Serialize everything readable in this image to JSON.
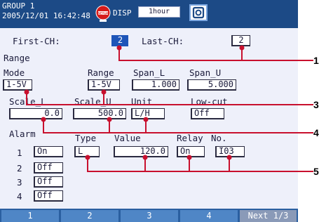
{
  "header": {
    "group": "GROUP 1",
    "datetime": "2005/12/01 16:42:48",
    "setup_badge": "SETUP",
    "disp_label": "DISP",
    "time_span": "1hour"
  },
  "channels": {
    "first_label": "First-CH:",
    "first_value": "2",
    "last_label": "Last-CH:",
    "last_value": "2"
  },
  "range": {
    "section_label": "Range",
    "mode_label": "Mode",
    "mode_value": "1-5V",
    "range_label": "Range",
    "range_value": "1-5V",
    "span_l_label": "Span_L",
    "span_l_value": "1.000",
    "span_u_label": "Span_U",
    "span_u_value": "5.000",
    "scale_l_label": "Scale_L",
    "scale_l_value": "0.0",
    "scale_u_label": "Scale_U",
    "scale_u_value": "500.0",
    "unit_label": "Unit",
    "unit_value": "L/H",
    "lowcut_label": "Low-cut",
    "lowcut_value": "Off"
  },
  "alarm": {
    "section_label": "Alarm",
    "type_label": "Type",
    "value_label": "Value",
    "relay_label": "Relay",
    "no_label": "No.",
    "rows": [
      {
        "num": "1",
        "state": "On",
        "type": "L",
        "value": "120.0",
        "relay": "On",
        "no": "I03"
      },
      {
        "num": "2",
        "state": "Off"
      },
      {
        "num": "3",
        "state": "Off"
      },
      {
        "num": "4",
        "state": "Off"
      }
    ]
  },
  "softkeys": [
    "1",
    "2",
    "3",
    "4",
    "Next 1/3"
  ],
  "callouts": [
    "1",
    "3",
    "4",
    "5"
  ],
  "colors": {
    "header_bg": "#1c4a86",
    "screen_bg": "#eef0fa",
    "selected_field": "#1e55b8",
    "callout_line": "#c8102e",
    "softkey_bg": "#4f86c6"
  }
}
